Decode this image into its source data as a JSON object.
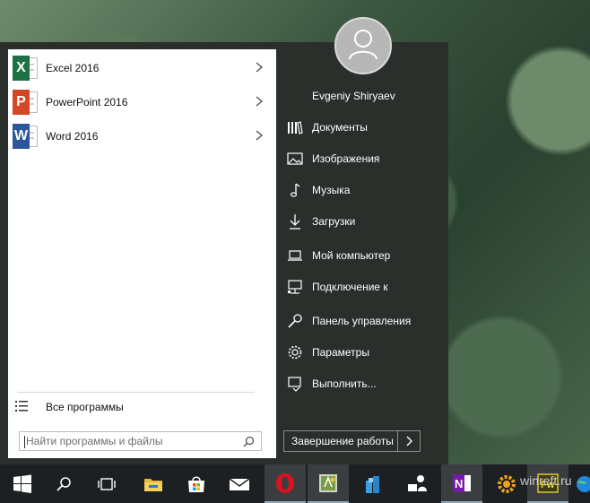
{
  "start_menu": {
    "apps": [
      {
        "label": "Excel 2016",
        "letter": "X",
        "color": "#1e7145"
      },
      {
        "label": "PowerPoint 2016",
        "letter": "P",
        "color": "#d24726"
      },
      {
        "label": "Word 2016",
        "letter": "W",
        "color": "#2b579a"
      }
    ],
    "all_programs": "Все программы",
    "search_placeholder": "Найти программы и файлы",
    "user_name": "Evgeniy Shiryaev",
    "places": [
      {
        "label": "Документы",
        "icon": "library-icon"
      },
      {
        "label": "Изображения",
        "icon": "pictures-icon"
      },
      {
        "label": "Музыка",
        "icon": "music-note-icon"
      },
      {
        "label": "Загрузки",
        "icon": "download-icon"
      },
      {
        "label": "Мой компьютер",
        "icon": "laptop-icon"
      },
      {
        "label": "Подключение к",
        "icon": "network-icon"
      },
      {
        "label": "Панель управления",
        "icon": "wrench-icon"
      },
      {
        "label": "Параметры",
        "icon": "gear-icon"
      },
      {
        "label": "Выполнить...",
        "icon": "run-icon"
      }
    ],
    "shutdown_label": "Завершение работы"
  },
  "taskbar": {
    "items": [
      "windows-start-icon",
      "search-icon",
      "task-view-icon",
      "file-explorer-icon",
      "store-icon",
      "mail-icon",
      "opera-icon",
      "app-icon",
      "blocks-icon",
      "network-people-icon",
      "onenote-icon",
      "settings-gear-icon",
      "fireworks-icon",
      "globe-icon"
    ]
  },
  "watermark": "winreft.ru",
  "colors": {
    "menu_bg": "#2b2f2c",
    "left_pane_bg": "#ffffff",
    "taskbar_bg": "#1d2022"
  }
}
